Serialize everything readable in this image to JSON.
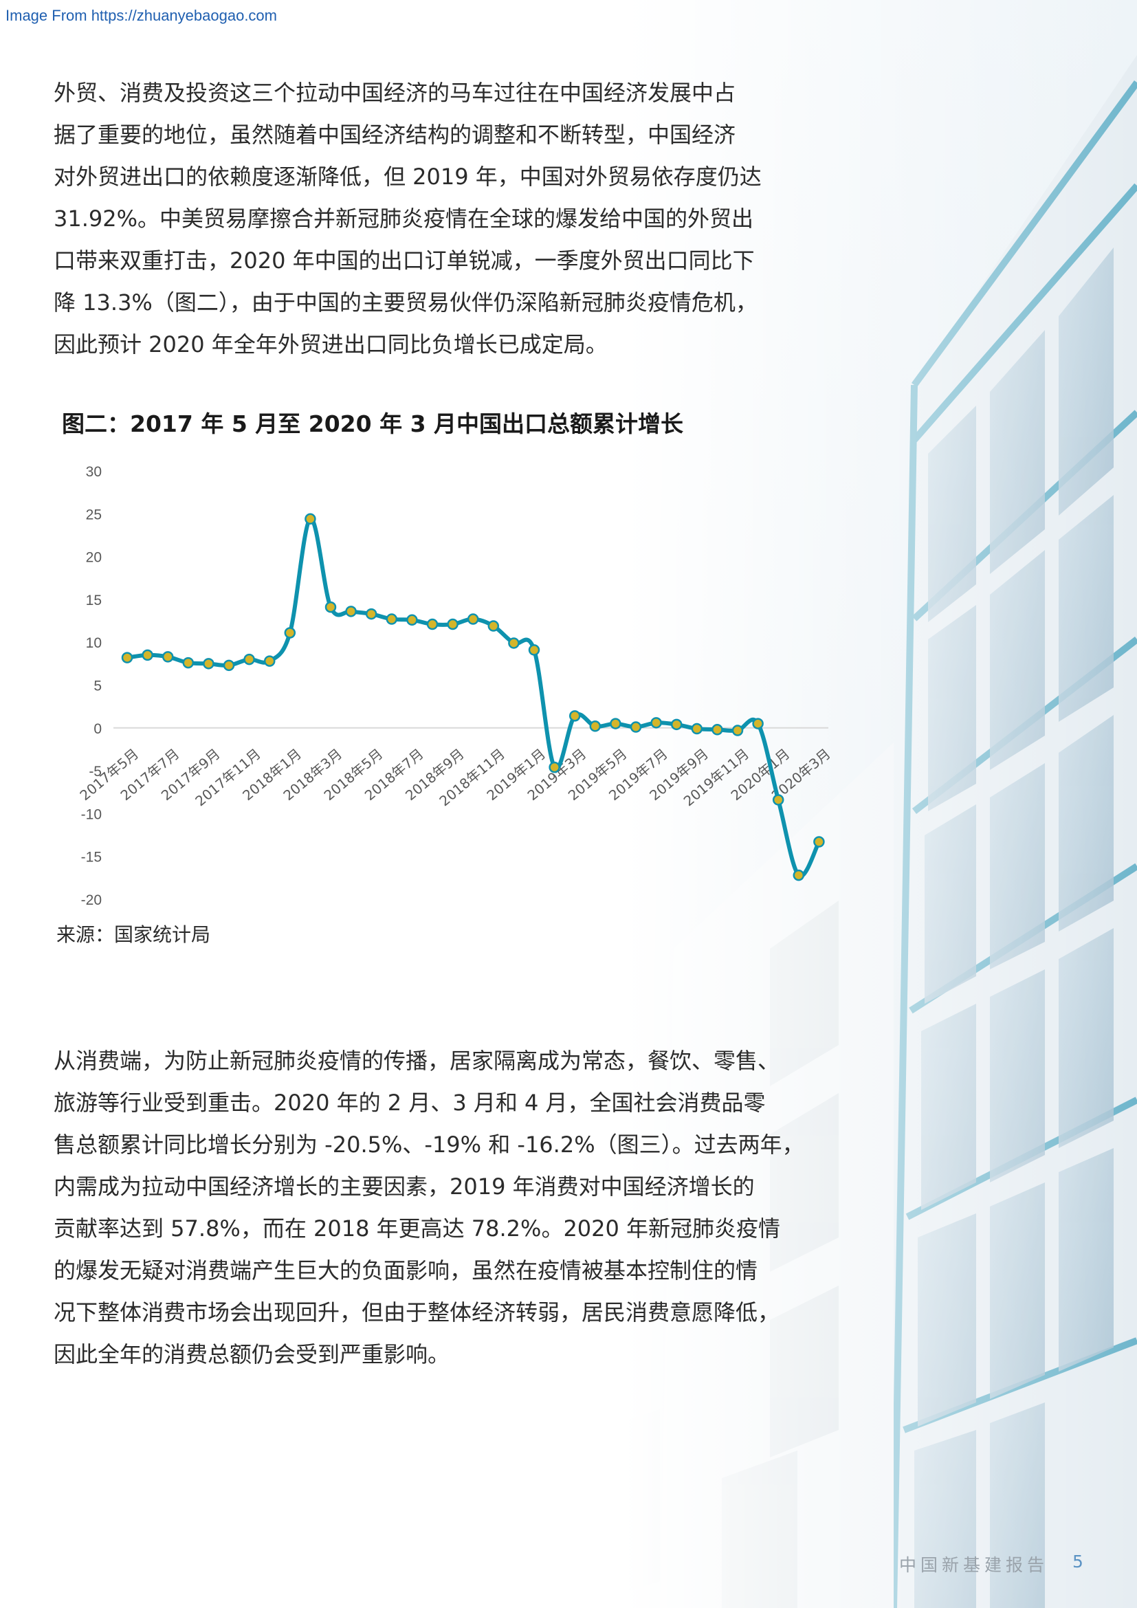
{
  "watermark": "Image From https://zhuanyebaogao.com",
  "paragraph1": [
    "外贸、消费及投资这三个拉动中国经济的马车过往在中国经济发展中占",
    "据了重要的地位，虽然随着中国经济结构的调整和不断转型，中国经济",
    "对外贸进出口的依赖度逐渐降低，但 2019 年，中国对外贸易依存度仍达",
    "31.92%。中美贸易摩擦合并新冠肺炎疫情在全球的爆发给中国的外贸出",
    "口带来双重打击，2020 年中国的出口订单锐减，一季度外贸出口同比下",
    "降 13.3%（图二），由于中国的主要贸易伙伴仍深陷新冠肺炎疫情危机，",
    "因此预计 2020 年全年外贸进出口同比负增长已成定局。"
  ],
  "figure": {
    "title": "图二：2017 年 5 月至 2020 年 3 月中国出口总额累计增长",
    "source": "来源：国家统计局"
  },
  "chart_data": {
    "type": "line",
    "title": "图二：2017 年 5 月至 2020 年 3 月中国出口总额累计增长",
    "xlabel": "",
    "ylabel": "",
    "ylim": [
      -20,
      30
    ],
    "yticks": [
      30,
      25,
      20,
      15,
      10,
      5,
      0,
      -5,
      -10,
      -15,
      -20
    ],
    "x_tick_labels": [
      "2017年5月",
      "2017年7月",
      "2017年9月",
      "2017年11月",
      "2018年1月",
      "2018年3月",
      "2018年5月",
      "2018年7月",
      "2018年9月",
      "2018年11月",
      "2019年1月",
      "2019年3月",
      "2019年5月",
      "2019年7月",
      "2019年9月",
      "2019年11月",
      "2020年1月",
      "2020年3月"
    ],
    "points": [
      {
        "x": "2017年5月",
        "y": 8.2
      },
      {
        "x": "2017年6月",
        "y": 8.5
      },
      {
        "x": "2017年7月",
        "y": 8.3
      },
      {
        "x": "2017年8月",
        "y": 7.6
      },
      {
        "x": "2017年9月",
        "y": 7.5
      },
      {
        "x": "2017年10月",
        "y": 7.3
      },
      {
        "x": "2017年11月",
        "y": 8.0
      },
      {
        "x": "2017年12月",
        "y": 7.8
      },
      {
        "x": "2018年1月",
        "y": 11.1
      },
      {
        "x": "2018年2月",
        "y": 24.4
      },
      {
        "x": "2018年3月",
        "y": 14.1
      },
      {
        "x": "2018年4月",
        "y": 13.6
      },
      {
        "x": "2018年5月",
        "y": 13.3
      },
      {
        "x": "2018年6月",
        "y": 12.7
      },
      {
        "x": "2018年7月",
        "y": 12.6
      },
      {
        "x": "2018年8月",
        "y": 12.1
      },
      {
        "x": "2018年9月",
        "y": 12.1
      },
      {
        "x": "2018年10月",
        "y": 12.7
      },
      {
        "x": "2018年11月",
        "y": 11.9
      },
      {
        "x": "2018年12月",
        "y": 9.9
      },
      {
        "x": "2019年1月",
        "y": 9.1
      },
      {
        "x": "2019年2月",
        "y": -4.6
      },
      {
        "x": "2019年3月",
        "y": 1.4
      },
      {
        "x": "2019年4月",
        "y": 0.2
      },
      {
        "x": "2019年5月",
        "y": 0.5
      },
      {
        "x": "2019年6月",
        "y": 0.1
      },
      {
        "x": "2019年7月",
        "y": 0.6
      },
      {
        "x": "2019年8月",
        "y": 0.4
      },
      {
        "x": "2019年9月",
        "y": -0.1
      },
      {
        "x": "2019年10月",
        "y": -0.2
      },
      {
        "x": "2019年11月",
        "y": -0.3
      },
      {
        "x": "2019年12月",
        "y": 0.5
      },
      {
        "x": "2020年1月",
        "y": -8.4
      },
      {
        "x": "2020年2月",
        "y": -17.2
      },
      {
        "x": "2020年3月",
        "y": -13.3
      }
    ],
    "grid": false,
    "zero_line": true,
    "smooth": true,
    "line_color": "#0e92ae",
    "marker_color": "#d4b52a"
  },
  "paragraph2": [
    "从消费端，为防止新冠肺炎疫情的传播，居家隔离成为常态，餐饮、零售、",
    "旅游等行业受到重击。2020 年的 2 月、3 月和 4 月，全国社会消费品零",
    "售总额累计同比增长分别为 -20.5%、-19% 和 -16.2%（图三）。过去两年，",
    "内需成为拉动中国经济增长的主要因素，2019 年消费对中国经济增长的",
    "贡献率达到 57.8%，而在 2018 年更高达 78.2%。2020 年新冠肺炎疫情",
    "的爆发无疑对消费端产生巨大的负面影响，虽然在疫情被基本控制住的情",
    "况下整体消费市场会出现回升，但由于整体经济转弱，居民消费意愿降低，",
    "因此全年的消费总额仍会受到严重影响。"
  ],
  "footer": {
    "report_title": "中国新基建报告",
    "page_number": "5"
  },
  "colors": {
    "watermark": "#1f5fb0",
    "footer_page": "#5b93c4",
    "building_frame": "#6fb6cc"
  }
}
